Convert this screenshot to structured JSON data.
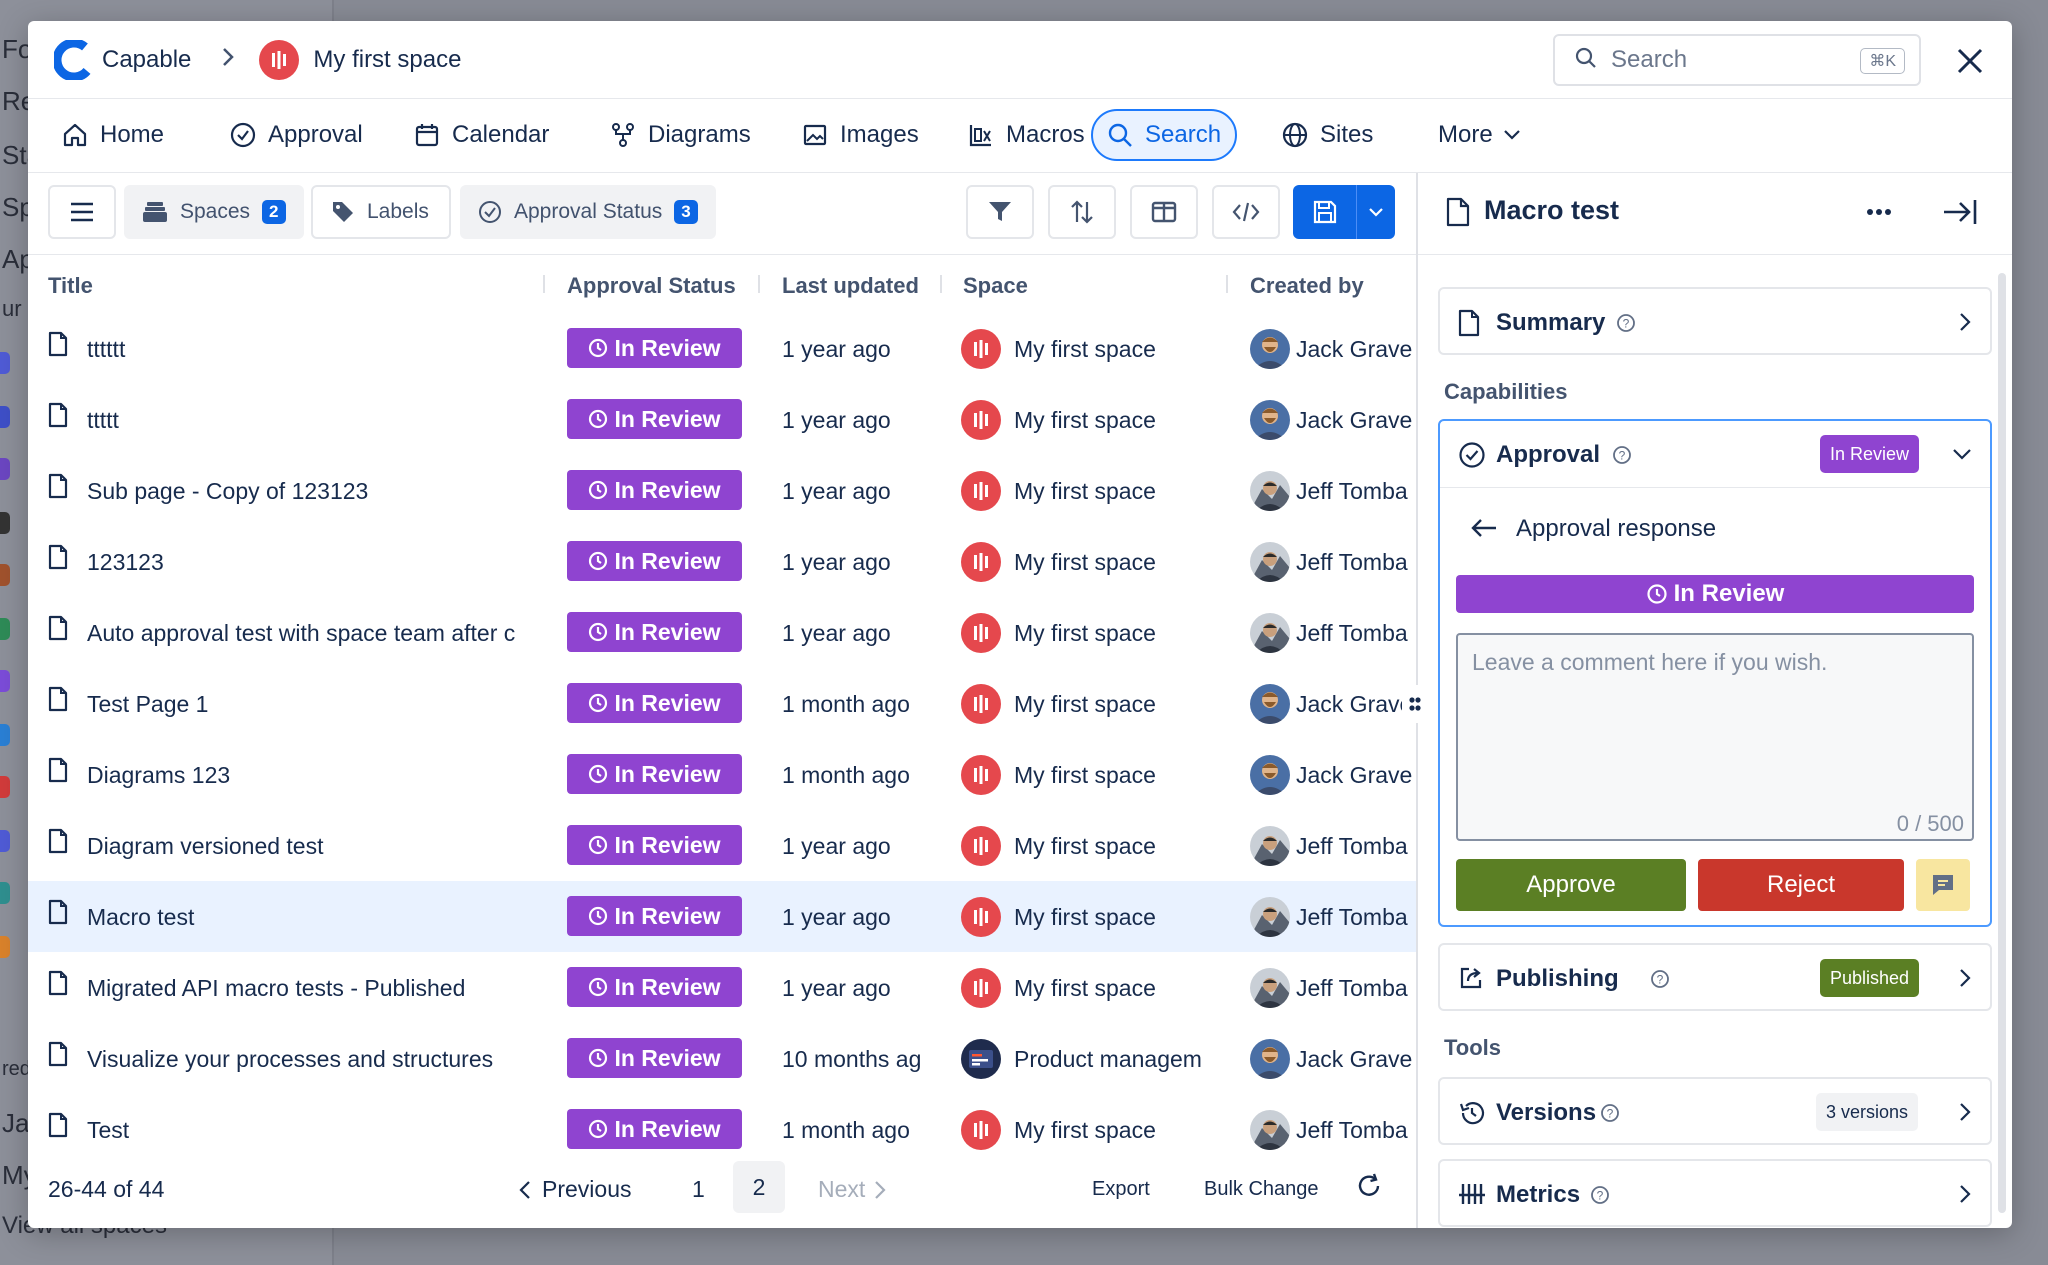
{
  "background": {
    "fragments": [
      "Fo",
      "Re",
      "Sta",
      "Sp",
      "Ap",
      "ur",
      "red",
      "Ja",
      "My",
      "View all spaces"
    ]
  },
  "header": {
    "brand": "Capable",
    "space": "My first space",
    "search_placeholder": "Search",
    "search_shortcut": "⌘K"
  },
  "nav": {
    "items": [
      {
        "label": "Home",
        "icon": "home-icon"
      },
      {
        "label": "Approval",
        "icon": "check-circle-icon"
      },
      {
        "label": "Calendar",
        "icon": "calendar-icon"
      },
      {
        "label": "Diagrams",
        "icon": "diagram-icon"
      },
      {
        "label": "Images",
        "icon": "image-icon"
      },
      {
        "label": "Macros",
        "icon": "macro-icon"
      },
      {
        "label": "Search",
        "icon": "search-icon",
        "active": true
      },
      {
        "label": "Sites",
        "icon": "globe-icon"
      },
      {
        "label": "More",
        "icon": "chevron-down-icon"
      }
    ]
  },
  "toolbar": {
    "spaces_label": "Spaces",
    "spaces_count": "2",
    "labels_label": "Labels",
    "approval_label": "Approval Status",
    "approval_count": "3"
  },
  "table": {
    "columns": [
      "Title",
      "Approval Status",
      "Last updated",
      "Space",
      "Created by"
    ],
    "rows": [
      {
        "title": "tttttt",
        "status": "In Review",
        "updated": "1 year ago",
        "space": "My first space",
        "creator": "Jack Grave",
        "avatar": "jack"
      },
      {
        "title": "ttttt",
        "status": "In Review",
        "updated": "1 year ago",
        "space": "My first space",
        "creator": "Jack Grave",
        "avatar": "jack"
      },
      {
        "title": "Sub page - Copy of 123123",
        "status": "In Review",
        "updated": "1 year ago",
        "space": "My first space",
        "creator": "Jeff Tomba",
        "avatar": "jeff"
      },
      {
        "title": "123123",
        "status": "In Review",
        "updated": "1 year ago",
        "space": "My first space",
        "creator": "Jeff Tomba",
        "avatar": "jeff"
      },
      {
        "title": "Auto approval test with space team after c",
        "status": "In Review",
        "updated": "1 year ago",
        "space": "My first space",
        "creator": "Jeff Tomba",
        "avatar": "jeff"
      },
      {
        "title": "Test Page 1",
        "status": "In Review",
        "updated": "1 month ago",
        "space": "My first space",
        "creator": "Jack Grave",
        "avatar": "jack"
      },
      {
        "title": "Diagrams 123",
        "status": "In Review",
        "updated": "1 month ago",
        "space": "My first space",
        "creator": "Jack Grave",
        "avatar": "jack"
      },
      {
        "title": "Diagram versioned test",
        "status": "In Review",
        "updated": "1 year ago",
        "space": "My first space",
        "creator": "Jeff Tomba",
        "avatar": "jeff"
      },
      {
        "title": "Macro test",
        "status": "In Review",
        "updated": "1 year ago",
        "space": "My first space",
        "creator": "Jeff Tomba",
        "avatar": "jeff",
        "selected": true
      },
      {
        "title": "Migrated API macro tests - Published",
        "status": "In Review",
        "updated": "1 year ago",
        "space": "My first space",
        "creator": "Jeff Tomba",
        "avatar": "jeff"
      },
      {
        "title": "Visualize your processes and structures",
        "status": "In Review",
        "updated": "10 months ag",
        "space": "Product managem",
        "creator": "Jack Grave",
        "avatar": "jack",
        "space_type": "pm"
      },
      {
        "title": "Test",
        "status": "In Review",
        "updated": "1 month ago",
        "space": "My first space",
        "creator": "Jeff Tomba",
        "avatar": "jeff"
      }
    ]
  },
  "footer": {
    "range": "26-44 of 44",
    "previous": "Previous",
    "page1": "1",
    "page2": "2",
    "next": "Next",
    "export": "Export",
    "bulk_change": "Bulk Change"
  },
  "panel": {
    "title": "Macro test",
    "summary": "Summary",
    "capabilities_heading": "Capabilities",
    "approval": "Approval",
    "approval_status": "In Review",
    "approval_response": "Approval response",
    "status_bar": "In Review",
    "comment_placeholder": "Leave a comment here if you wish.",
    "char_count": "0 / 500",
    "approve": "Approve",
    "reject": "Reject",
    "publishing": "Publishing",
    "publishing_status": "Published",
    "tools_heading": "Tools",
    "versions": "Versions",
    "versions_count": "3 versions",
    "metrics": "Metrics"
  },
  "colors": {
    "accent": "#0c66e4",
    "review_purple": "#8f44d0",
    "approve_green": "#5b7f24",
    "reject_red": "#c9372c",
    "space_red": "#e5484d"
  }
}
